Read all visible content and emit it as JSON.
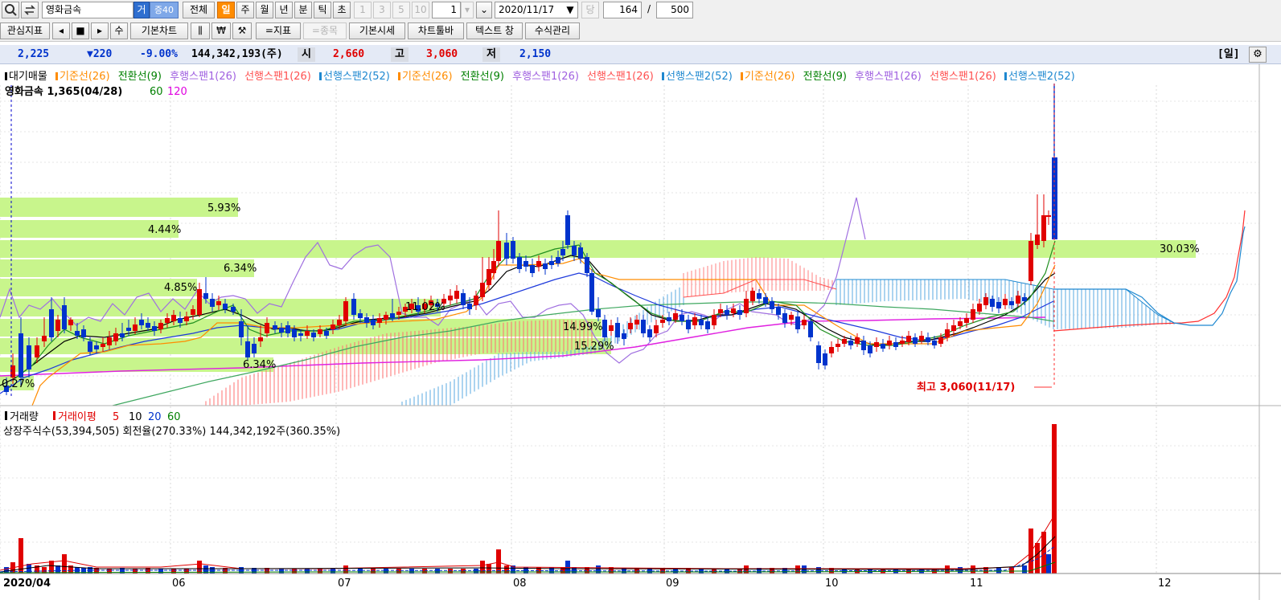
{
  "toolbar": {
    "stock_name": "영화금속",
    "trade_badge": "거",
    "count_badge": "증40",
    "btn_all": "전체",
    "periods": [
      "일",
      "주",
      "월",
      "년",
      "분",
      "틱",
      "초"
    ],
    "interval_nums": [
      "1",
      "3",
      "5",
      "10"
    ],
    "interval_value": "1",
    "date_value": "2020/11/17",
    "dang_label": "당",
    "count_value": "164",
    "slash": "/",
    "total_value": "500",
    "btn_watch": "관심지표",
    "btn_basic_chart": "기본차트",
    "btn_su": "수",
    "btn_indicator": "=지표",
    "btn_item": "=종목",
    "btn_basic_price": "기본시세",
    "btn_chart_toolbar": "차트툴바",
    "btn_text_window": "텍스트 창",
    "btn_formula": "수식관리",
    "won_sign": "₩"
  },
  "quote": {
    "price": "2,225",
    "change": "▼220",
    "change_rate": "-9.00%",
    "volume": "144,342,193(주)",
    "open_label": "시",
    "open": "2,660",
    "high_label": "고",
    "high": "3,060",
    "low_label": "저",
    "low": "2,150",
    "period_tag": "[일]"
  },
  "legend": [
    {
      "text": "대기매물",
      "color": "#000000"
    },
    {
      "text": "기준선(26)",
      "color": "#ff8c00"
    },
    {
      "text": "전환선(9)",
      "color": "#008000"
    },
    {
      "text": "후행스팬1(26)",
      "color": "#a060e0"
    },
    {
      "text": "선행스팬1(26)",
      "color": "#ff5050"
    },
    {
      "text": "선행스팬2(52)",
      "color": "#1e88d0"
    },
    {
      "text": "기준선(26)",
      "color": "#ff8c00"
    },
    {
      "text": "전환선(9)",
      "color": "#008000"
    },
    {
      "text": "후행스팬1(26)",
      "color": "#a060e0"
    },
    {
      "text": "선행스팬1(26)",
      "color": "#ff5050"
    },
    {
      "text": "선행스팬2(52)",
      "color": "#1e88d0"
    },
    {
      "text": "기준선(26)",
      "color": "#ff8c00"
    },
    {
      "text": "전환선(9)",
      "color": "#008000"
    },
    {
      "text": "후행스팬1(26)",
      "color": "#a060e0"
    },
    {
      "text": "선행스팬1(26)",
      "color": "#ff5050"
    },
    {
      "text": "선행스팬2(52)",
      "color": "#1e88d0"
    }
  ],
  "price_pane": {
    "title_overlay": "영화금속 1,365(04/28)",
    "ma_labels": [
      {
        "text": "60",
        "color": "#008000"
      },
      {
        "text": "120",
        "color": "#e000e0"
      }
    ],
    "high_note": "최고 3,060(11/17)",
    "band_labels": [
      "5.93%",
      "4.44%",
      "6.34%",
      "4.85%",
      "11.02%",
      "14.99%",
      "15.29%",
      "6.34%",
      "0.27%",
      "30.03%"
    ]
  },
  "volume_pane": {
    "title": "거래량",
    "ma_title": "거래이평",
    "ma_periods": [
      {
        "text": "5",
        "color": "#e00000"
      },
      {
        "text": "10",
        "color": "#000000"
      },
      {
        "text": "20",
        "color": "#0033cc"
      },
      {
        "text": "60",
        "color": "#008000"
      }
    ],
    "info": "상장주식수(53,394,505) 회전율(270.33%) 144,342,192주(360.35%)"
  },
  "x_axis": [
    "2020/04",
    "06",
    "07",
    "08",
    "09",
    "10",
    "11",
    "12"
  ],
  "colors": {
    "up": "#e00000",
    "down": "#0033cc",
    "band": "#c8f58c",
    "accent": "#ff8c00"
  },
  "chart_data": {
    "type": "candlestick",
    "period": "daily",
    "date_range": [
      "2020/04",
      "2020/11/17"
    ],
    "last": {
      "date": "2020/11/17",
      "open": 2660,
      "high": 3060,
      "low": 2150,
      "close": 2225,
      "change": -220,
      "change_rate": -9.0,
      "volume": 144342193
    },
    "period_high": {
      "value": 3060,
      "date": "11/17"
    },
    "low_marker": {
      "value": 1365,
      "date": "04/28"
    },
    "indicators": [
      "기준선(26)",
      "전환선(9)",
      "후행스팬1(26)",
      "선행스팬1(26)",
      "선행스팬2(52)",
      "MA60",
      "MA120"
    ],
    "volume_ma": [
      5,
      10,
      20,
      60
    ]
  }
}
